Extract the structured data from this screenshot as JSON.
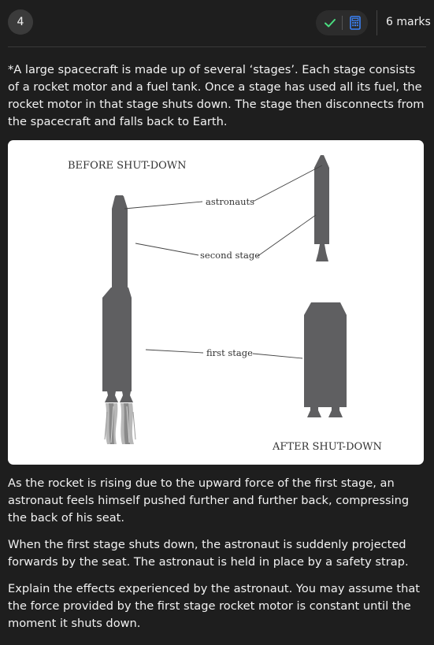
{
  "header": {
    "question_number": "4",
    "marks": "6 marks",
    "tools": {
      "check_icon": "check-icon",
      "calculator_icon": "calculator-icon"
    }
  },
  "intro": "*A large spacecraft is made up of several ‘stages’. Each stage consists of a rocket motor and a fuel tank. Once a stage has used all its fuel, the rocket motor in that stage shuts down. The stage then disconnects from the spacecraft and falls back to Earth.",
  "figure": {
    "before_label": "BEFORE SHUT-DOWN",
    "after_label": "AFTER SHUT-DOWN",
    "labels": {
      "astronauts": "astronauts",
      "second_stage": "second stage",
      "first_stage": "first stage"
    }
  },
  "paragraphs": [
    "As the rocket is rising due to the upward force of the first stage, an astronaut feels himself pushed further and further back, compressing the back of his seat.",
    "When the first stage shuts down, the astronaut is suddenly projected forwards by the seat. The astronaut is held in place by a safety strap.",
    "Explain the effects experienced by the astronaut. You may assume that the force provided by the first stage rocket motor is constant until the moment it shuts down."
  ],
  "colors": {
    "background": "#1e1e1e",
    "accent_green": "#4ade80",
    "accent_blue": "#3b82f6",
    "rocket_gray": "#5f5f61"
  }
}
